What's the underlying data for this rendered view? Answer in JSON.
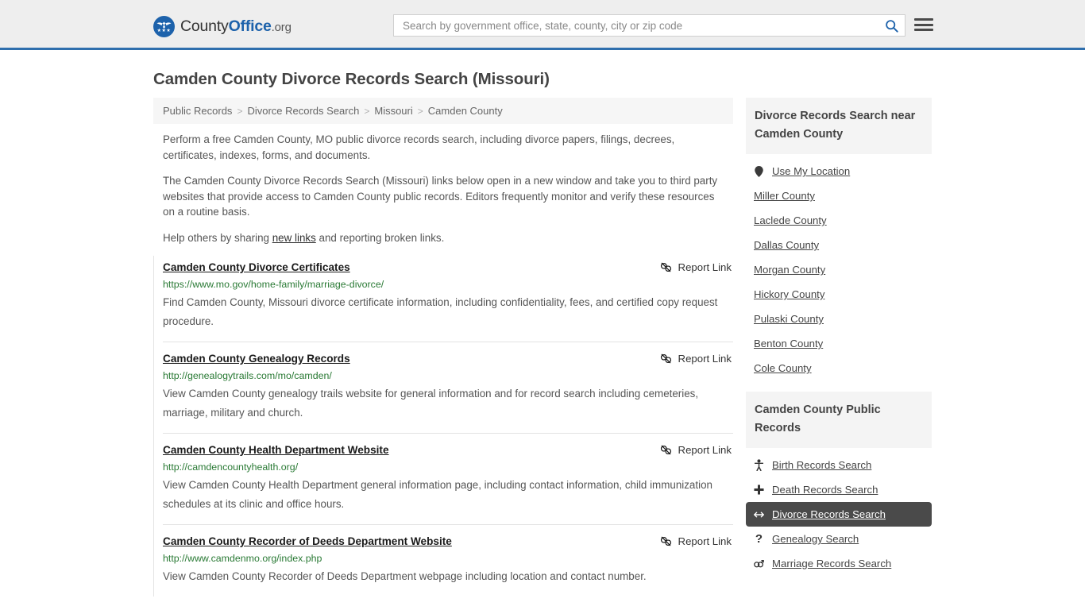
{
  "header": {
    "brand": {
      "part1": "County",
      "part2": "Office",
      "part3": ".org"
    },
    "search": {
      "placeholder": "Search by government office, state, county, city or zip code",
      "value": "",
      "search_icon": "search-icon"
    },
    "menu_icon": "hamburger-menu-icon"
  },
  "page": {
    "title": "Camden County Divorce Records Search (Missouri)"
  },
  "breadcrumb": {
    "items": [
      {
        "label": "Public Records"
      },
      {
        "label": "Divorce Records Search"
      },
      {
        "label": "Missouri"
      },
      {
        "label": "Camden County"
      }
    ],
    "separator": ">"
  },
  "intro": {
    "p1": "Perform a free Camden County, MO public divorce records search, including divorce papers, filings, decrees, certificates, indexes, forms, and documents.",
    "p2": "The Camden County Divorce Records Search (Missouri) links below open in a new window and take you to third party websites that provide access to Camden County public records. Editors frequently monitor and verify these resources on a routine basis.",
    "p3_before": "Help others by sharing ",
    "p3_link": "new links",
    "p3_after": " and reporting broken links."
  },
  "report_link_label": "Report Link",
  "report_link_icon": "broken-link-icon",
  "results": [
    {
      "title": "Camden County Divorce Certificates",
      "url": "https://www.mo.gov/home-family/marriage-divorce/",
      "description": "Find Camden County, Missouri divorce certificate information, including confidentiality, fees, and certified copy request procedure."
    },
    {
      "title": "Camden County Genealogy Records",
      "url": "http://genealogytrails.com/mo/camden/",
      "description": "View Camden County genealogy trails website for general information and for record search including cemeteries, marriage, military and church."
    },
    {
      "title": "Camden County Health Department Website",
      "url": "http://camdencountyhealth.org/",
      "description": "View Camden County Health Department general information page, including contact information, child immunization schedules at its clinic and office hours."
    },
    {
      "title": "Camden County Recorder of Deeds Department Website",
      "url": "http://www.camdenmo.org/index.php",
      "description": "View Camden County Recorder of Deeds Department webpage including location and contact number."
    }
  ],
  "sidebar": {
    "nearby": {
      "heading": "Divorce Records Search near Camden County",
      "items": [
        {
          "label": "Use My Location",
          "icon": "map-pin-icon"
        },
        {
          "label": "Miller County",
          "icon": ""
        },
        {
          "label": "Laclede County",
          "icon": ""
        },
        {
          "label": "Dallas County",
          "icon": ""
        },
        {
          "label": "Morgan County",
          "icon": ""
        },
        {
          "label": "Hickory County",
          "icon": ""
        },
        {
          "label": "Pulaski County",
          "icon": ""
        },
        {
          "label": "Benton County",
          "icon": ""
        },
        {
          "label": "Cole County",
          "icon": ""
        }
      ]
    },
    "public_records": {
      "heading": "Camden County Public Records",
      "items": [
        {
          "label": "Birth Records Search",
          "icon": "baby-icon",
          "glyph": "Ѧ",
          "active": false
        },
        {
          "label": "Death Records Search",
          "icon": "cross-icon",
          "glyph": "✚",
          "active": false
        },
        {
          "label": "Divorce Records Search",
          "icon": "left-right-arrow-icon",
          "glyph": "↔",
          "active": true
        },
        {
          "label": "Genealogy Search",
          "icon": "question-mark-icon",
          "glyph": "?",
          "active": false
        },
        {
          "label": "Marriage Records Search",
          "icon": "male-female-icon",
          "glyph": "⚥",
          "active": false
        }
      ]
    }
  },
  "colors": {
    "brand_blue": "#1d62ab",
    "header_bg": "#eeeeee",
    "header_border": "#2f6fad",
    "url_green": "#2a7a35",
    "active_bg": "#4a4a4a"
  }
}
